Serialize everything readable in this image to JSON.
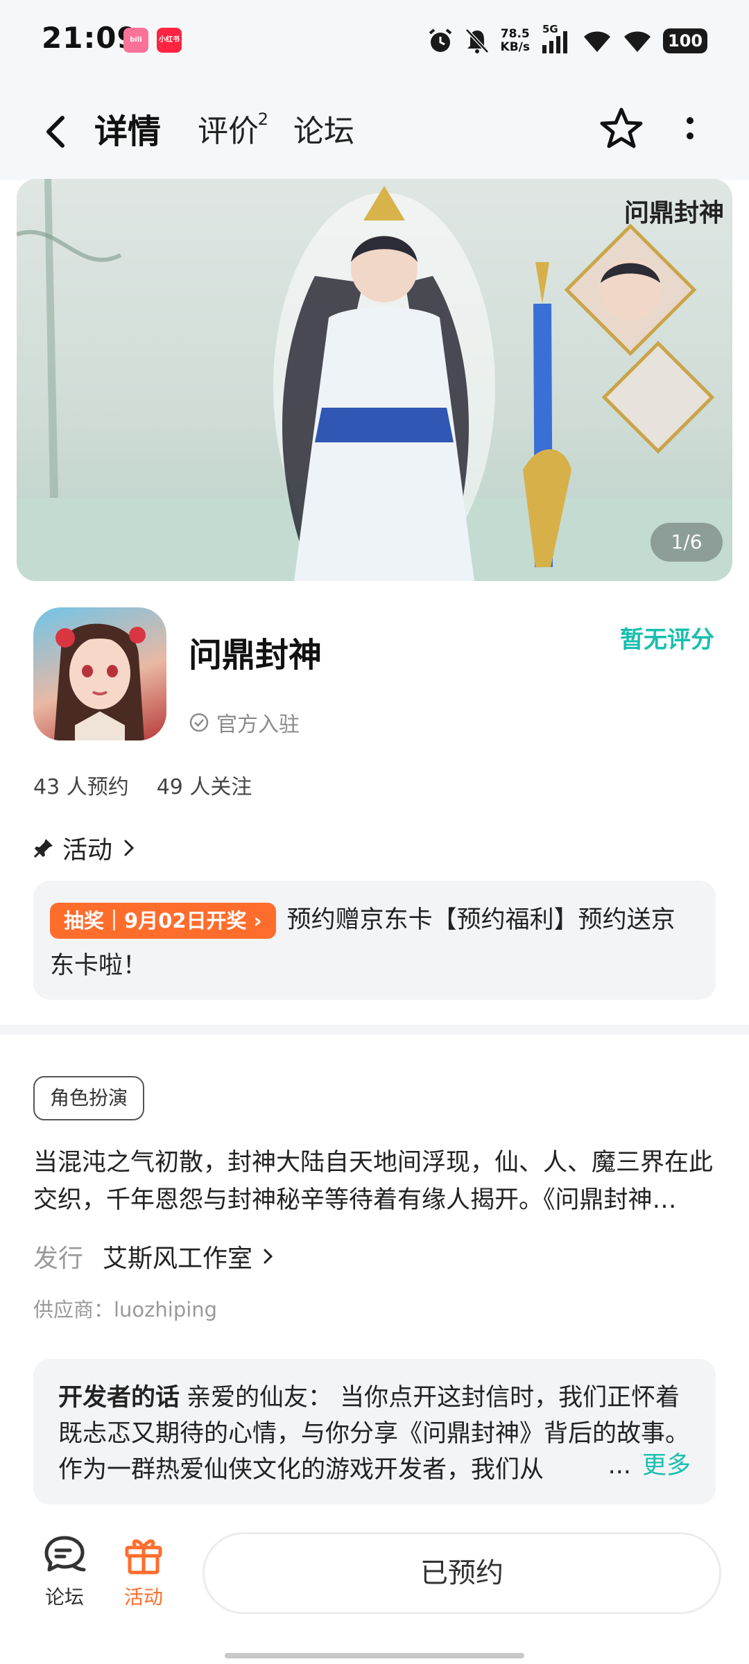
{
  "status_bar": {
    "time": "21:09",
    "app_badges": [
      "bilibili",
      "小红书"
    ],
    "net_speed": "78.5",
    "net_unit": "KB/s",
    "signal_label": "5G",
    "battery": "100",
    "icons": [
      "alarm-icon",
      "mute-bell-icon",
      "signal-icon",
      "wifi-icon",
      "wifi-icon"
    ]
  },
  "header": {
    "back_icon": "chevron-left-icon",
    "tabs": [
      {
        "label": "详情",
        "active": true
      },
      {
        "label": "评价",
        "badge": "2"
      },
      {
        "label": "论坛"
      }
    ],
    "favorite_icon": "star-icon",
    "more_icon": "more-vertical-icon"
  },
  "banner": {
    "title": "问鼎封神",
    "counter": "1/6"
  },
  "app": {
    "name": "问鼎封神",
    "official_label": "官方入驻",
    "rating": "暂无评分",
    "reservations": "43 人预约",
    "followers": "49 人关注"
  },
  "activity": {
    "heading": "活动",
    "tag": "抽奖｜9月02日开奖 ›",
    "text": "预约赠京东卡【预约福利】预约送京东卡啦！"
  },
  "details": {
    "genre": "角色扮演",
    "description": "当混沌之气初散，封神大陆自天地间浮现，仙、人、魔三界在此交织，千年恩怨与封神秘辛等待着有缘人揭开。《问鼎封神…",
    "publisher_label": "发行",
    "publisher": "艾斯风工作室",
    "supplier": "供应商：luozhiping"
  },
  "developer_note": {
    "label": "开发者的话",
    "text": "亲爱的仙友： 当你点开这封信时，我们正怀着既忐忑又期待的心情，与你分享《问鼎封神》背后的故事。作为一群热爱仙侠文化的游戏开发者，我们从",
    "ellipsis": "...",
    "more": "更多"
  },
  "bottom_bar": {
    "forum_label": "论坛",
    "activity_label": "活动",
    "reserve_button": "已预约"
  },
  "colors": {
    "accent": "#18bfae",
    "orange": "#ff6d2d",
    "card_bg": "#f3f4f6"
  }
}
